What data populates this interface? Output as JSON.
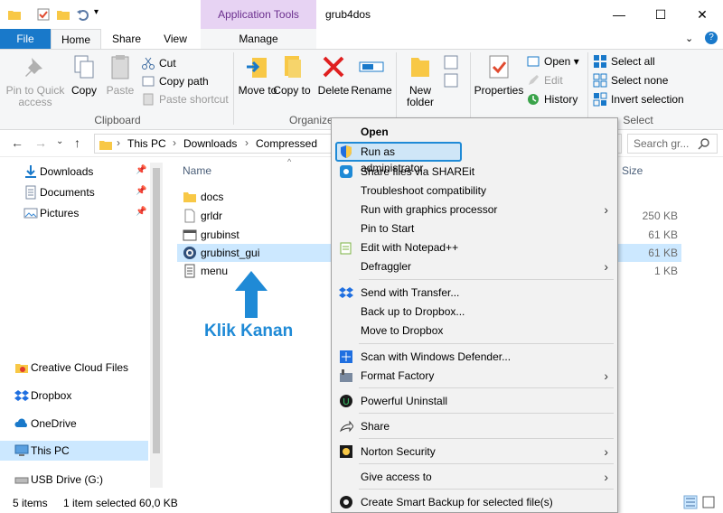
{
  "window": {
    "title": "grub4dos",
    "context_tab_header": "Application Tools",
    "minimize": "—",
    "maximize": "☐",
    "close": "✕"
  },
  "tabs": [
    "File",
    "Home",
    "Share",
    "View",
    "Manage"
  ],
  "ribbon": {
    "clipboard": {
      "pin": "Pin to Quick access",
      "copy": "Copy",
      "paste": "Paste",
      "cut": "Cut",
      "copy_path": "Copy path",
      "paste_shortcut": "Paste shortcut",
      "label": "Clipboard"
    },
    "organize": {
      "move_to": "Move to",
      "copy_to": "Copy to",
      "delete": "Delete",
      "rename": "Rename",
      "label": "Organize"
    },
    "new": {
      "new_folder": "New folder"
    },
    "open": {
      "properties": "Properties",
      "open": "Open",
      "edit": "Edit",
      "history": "History"
    },
    "select": {
      "select_all": "Select all",
      "select_none": "Select none",
      "invert": "Invert selection",
      "label": "Select"
    }
  },
  "address": {
    "crumbs": [
      "This PC",
      "Downloads",
      "Compressed"
    ],
    "search_placeholder": "Search gr..."
  },
  "nav": {
    "quick": [
      "Downloads",
      "Documents",
      "Pictures"
    ],
    "other": [
      "Creative Cloud Files",
      "Dropbox",
      "OneDrive",
      "This PC",
      "USB Drive (G:)"
    ]
  },
  "columns": {
    "name": "Name",
    "size": "Size"
  },
  "files": [
    {
      "name": "docs",
      "size": ""
    },
    {
      "name": "grldr",
      "size": "250 KB"
    },
    {
      "name": "grubinst",
      "size": "61 KB"
    },
    {
      "name": "grubinst_gui",
      "size": "61 KB"
    },
    {
      "name": "menu",
      "size": "1 KB"
    }
  ],
  "status": {
    "items": "5 items",
    "selected": "1 item selected  60,0 KB"
  },
  "annotation": "Klik Kanan",
  "context_menu": [
    "Open",
    "Run as administrator",
    "Share files via SHAREit",
    "Troubleshoot compatibility",
    "Run with graphics processor",
    "Pin to Start",
    "Edit with Notepad++",
    "Defraggler",
    "Send with Transfer...",
    "Back up to Dropbox...",
    "Move to Dropbox",
    "Scan with Windows Defender...",
    "Format Factory",
    "Powerful Uninstall",
    "Share",
    "Norton Security",
    "Give access to",
    "Create Smart Backup for selected file(s)"
  ],
  "colors": {
    "accent": "#1979ca",
    "highlight": "#cce8ff",
    "annotation": "#1f8ad6",
    "context_tab": "#e7d3f3"
  }
}
